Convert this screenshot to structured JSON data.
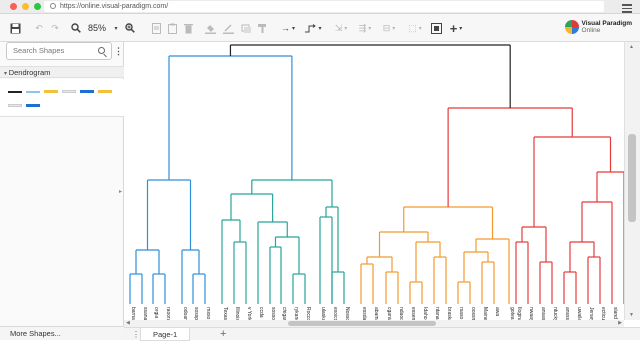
{
  "browser": {
    "url": "https://online.visual-paradigm.com/",
    "dot_colors": [
      "#fc5f57",
      "#fdbc2e",
      "#28c840"
    ]
  },
  "toolbar": {
    "zoom": "85%",
    "brand_title": "Visual Paradigm",
    "brand_subtitle": "Online"
  },
  "sidebar": {
    "search_placeholder": "Search Shapes",
    "category": "Dendrogram",
    "more_shapes": "More Shapes..."
  },
  "pages": {
    "tab_label": "Page-1"
  },
  "dendrogram": {
    "colors": {
      "root": "#222222",
      "blue": "#2f8fd8",
      "teal": "#27a59a",
      "orange": "#f29a2e",
      "red": "#e53b3b"
    },
    "leaves": [
      "barna",
      "ssana",
      "orgia",
      "raoora",
      "odoan",
      "sossp",
      "rnsso",
      "Texas",
      "Illinois",
      "v York",
      "ccda",
      "sosso",
      "chigan",
      "rykand",
      "Rocco",
      "ulaska",
      "exoico",
      "Nosso",
      "essda",
      "abama",
      "cgania",
      "ndaoda",
      "essent",
      "Idaho",
      "ntana",
      "braska",
      "rsaso",
      "oossn",
      "Maine",
      "awa",
      "gotea",
      "Ilogina",
      "nwaay",
      "ansas",
      "ntucky",
      "ansss",
      "uwaila",
      "Jersey",
      "ecticut",
      "sland",
      "essssi"
    ]
  }
}
